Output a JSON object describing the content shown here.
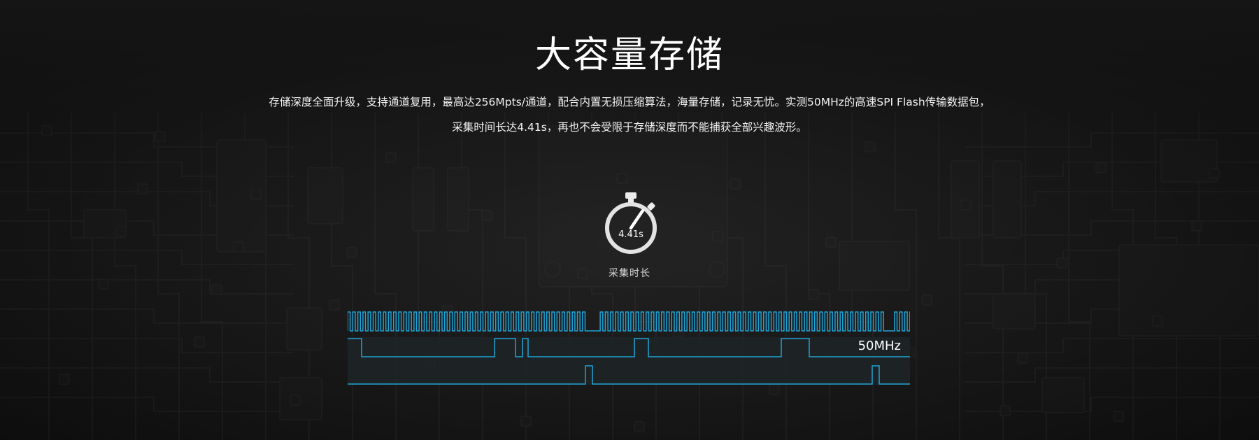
{
  "section": {
    "title": "大容量存储",
    "description_line1": "存储深度全面升级，支持通道复用，最高达256Mpts/通道，配合内置无损压缩算法，海量存储，记录无忧。实测50MHz的高速SPI Flash传输数据包，",
    "description_line2": "采集时间长达4.41s，再也不会受限于存储深度而不能捕获全部兴趣波形。"
  },
  "timer": {
    "icon": "stopwatch-icon",
    "value": "4.41s",
    "label": "采集时长"
  },
  "waveform": {
    "frequency_label": "50MHz",
    "line_color": "#1fa3d6"
  },
  "colors": {
    "background": "#141414",
    "accent": "#1fa3d6"
  }
}
